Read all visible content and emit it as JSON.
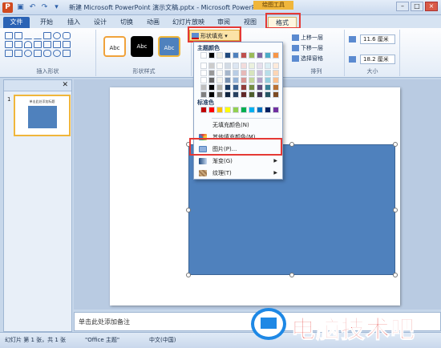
{
  "window": {
    "title": "新建 Microsoft PowerPoint 演示文稿.pptx - Microsoft PowerPoint",
    "context_tab_group": "绘图工具"
  },
  "tabs": [
    "文件",
    "开始",
    "插入",
    "设计",
    "切换",
    "动画",
    "幻灯片放映",
    "审阅",
    "视图",
    "格式"
  ],
  "ribbon": {
    "group_insert_shapes": "插入形状",
    "group_shape_styles": "形状样式",
    "group_arrange": "排列",
    "group_size": "大小",
    "style_label": "Abc",
    "shape_fill": "形状填充",
    "bring_forward": "上移一层",
    "send_backward": "下移一层",
    "selection_pane": "选择窗格",
    "height_value": "11.6 厘米",
    "width_value": "18.2 厘米"
  },
  "fill_menu": {
    "theme_colors_label": "主题颜色",
    "standard_colors_label": "标准色",
    "no_fill": "无填充颜色(N)",
    "more_fill_colors": "其他填充颜色(M)...",
    "picture": "图片(P)...",
    "gradient": "渐变(G)",
    "texture": "纹理(T)",
    "theme_top_row": [
      "#ffffff",
      "#000000",
      "#eeece1",
      "#1f497d",
      "#4f81bd",
      "#c0504d",
      "#9bbb59",
      "#8064a2",
      "#4bacc6",
      "#f79646"
    ],
    "standard_colors": [
      "#c00000",
      "#ff0000",
      "#ffc000",
      "#ffff00",
      "#92d050",
      "#00b050",
      "#00b0f0",
      "#0070c0",
      "#002060",
      "#7030a0"
    ]
  },
  "left_pane": {
    "slide_number": "1",
    "thumb_title": "单击此处添加标题"
  },
  "notes_placeholder": "单击此处添加备注",
  "status": {
    "slide_info": "幻灯片 第 1 张，共 1 张",
    "theme": "\"Office 主题\"",
    "language": "中文(中国)"
  },
  "watermark": {
    "text": "电脑技术吧"
  },
  "colors": {
    "accent": "#4f81bd",
    "highlight": "#e53935",
    "file_tab": "#2b63b5"
  }
}
